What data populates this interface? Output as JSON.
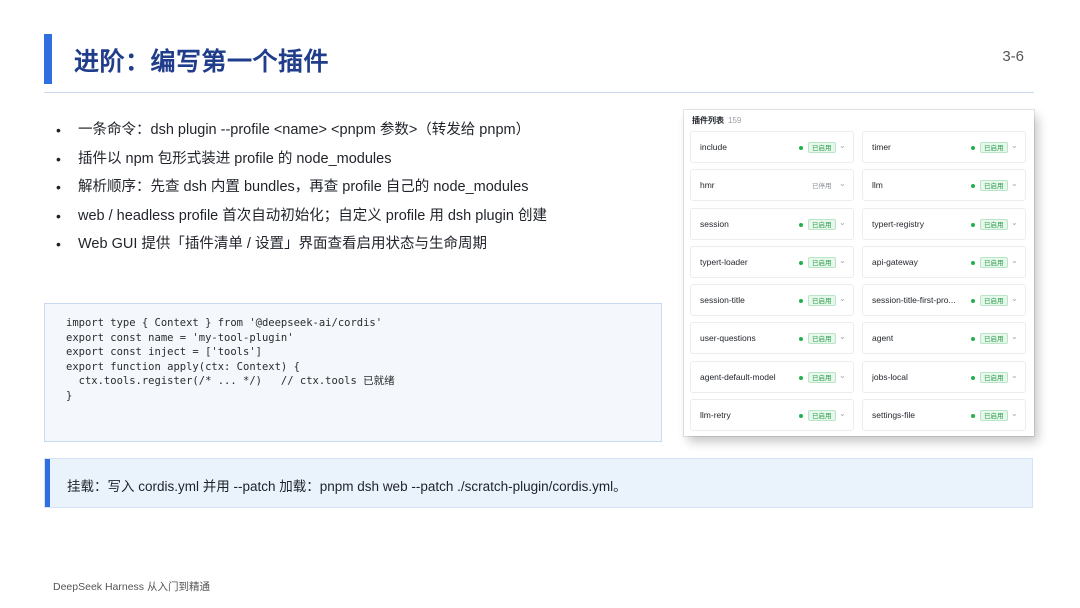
{
  "slide": {
    "title": "进阶：编写第一个插件",
    "page_number": "3-6",
    "footer": "DeepSeek Harness 从入门到精通"
  },
  "bullets": [
    "一条命令：dsh plugin --profile <name> <pnpm 参数>（转发给 pnpm）",
    "插件以 npm 包形式装进 profile 的 node_modules",
    "解析顺序：先查 dsh 内置 bundles，再查 profile 自己的 node_modules",
    "web / headless profile 首次自动初始化；自定义 profile 用 dsh plugin 创建",
    "Web GUI 提供「插件清单 / 设置」界面查看启用状态与生命周期"
  ],
  "code": {
    "text": "import type { Context } from '@deepseek-ai/cordis'\nexport const name = 'my-tool-plugin'\nexport const inject = ['tools']\nexport function apply(ctx: Context) {\n  ctx.tools.register(/* ... */)   // ctx.tools 已就绪\n}"
  },
  "plugin_panel": {
    "title": "插件列表",
    "count": "159",
    "status_color_enabled": "#22b14c",
    "plugins": [
      {
        "name": "include",
        "status": "已启用",
        "enabled": true
      },
      {
        "name": "timer",
        "status": "已启用",
        "enabled": true
      },
      {
        "name": "hmr",
        "status": "已停用",
        "enabled": false
      },
      {
        "name": "llm",
        "status": "已启用",
        "enabled": true
      },
      {
        "name": "session",
        "status": "已启用",
        "enabled": true
      },
      {
        "name": "typert-registry",
        "status": "已启用",
        "enabled": true
      },
      {
        "name": "typert-loader",
        "status": "已启用",
        "enabled": true
      },
      {
        "name": "api-gateway",
        "status": "已启用",
        "enabled": true
      },
      {
        "name": "session-title",
        "status": "已启用",
        "enabled": true
      },
      {
        "name": "session-title-first-pro...",
        "status": "已启用",
        "enabled": true
      },
      {
        "name": "user-questions",
        "status": "已启用",
        "enabled": true
      },
      {
        "name": "agent",
        "status": "已启用",
        "enabled": true
      },
      {
        "name": "agent-default-model",
        "status": "已启用",
        "enabled": true
      },
      {
        "name": "jobs-local",
        "status": "已启用",
        "enabled": true
      },
      {
        "name": "llm-retry",
        "status": "已启用",
        "enabled": true
      },
      {
        "name": "settings-file",
        "status": "已启用",
        "enabled": true
      }
    ]
  },
  "note": {
    "text": "挂载：写入 cordis.yml 并用 --patch 加载：pnpm dsh web --patch ./scratch-plugin/cordis.yml。"
  },
  "colors": {
    "accent": "#2f6fe0",
    "title": "#1f3d8a",
    "note_bg": "#eaf2fc"
  }
}
